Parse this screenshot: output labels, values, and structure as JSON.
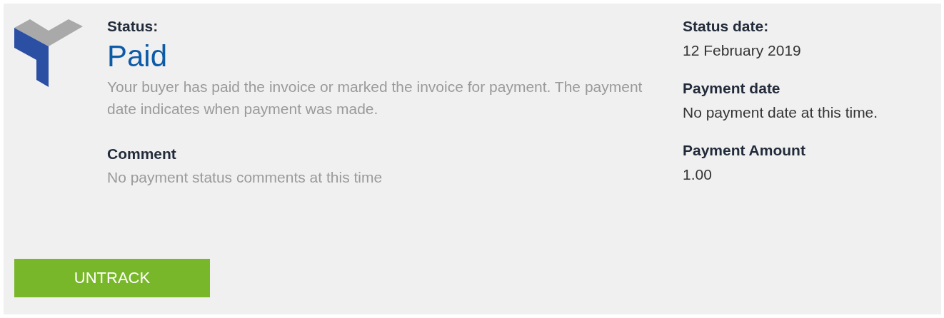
{
  "status": {
    "label": "Status:",
    "value": "Paid",
    "description": "Your buyer has paid the invoice or marked the invoice for payment. The payment date indicates when payment was made."
  },
  "comment": {
    "label": "Comment",
    "value": "No payment status comments at this time"
  },
  "details": [
    {
      "label": "Status date:",
      "value": "12 February 2019"
    },
    {
      "label": "Payment date",
      "value": "No payment date at this time."
    },
    {
      "label": "Payment Amount",
      "value": "1.00"
    }
  ],
  "button": "UNTRACK"
}
